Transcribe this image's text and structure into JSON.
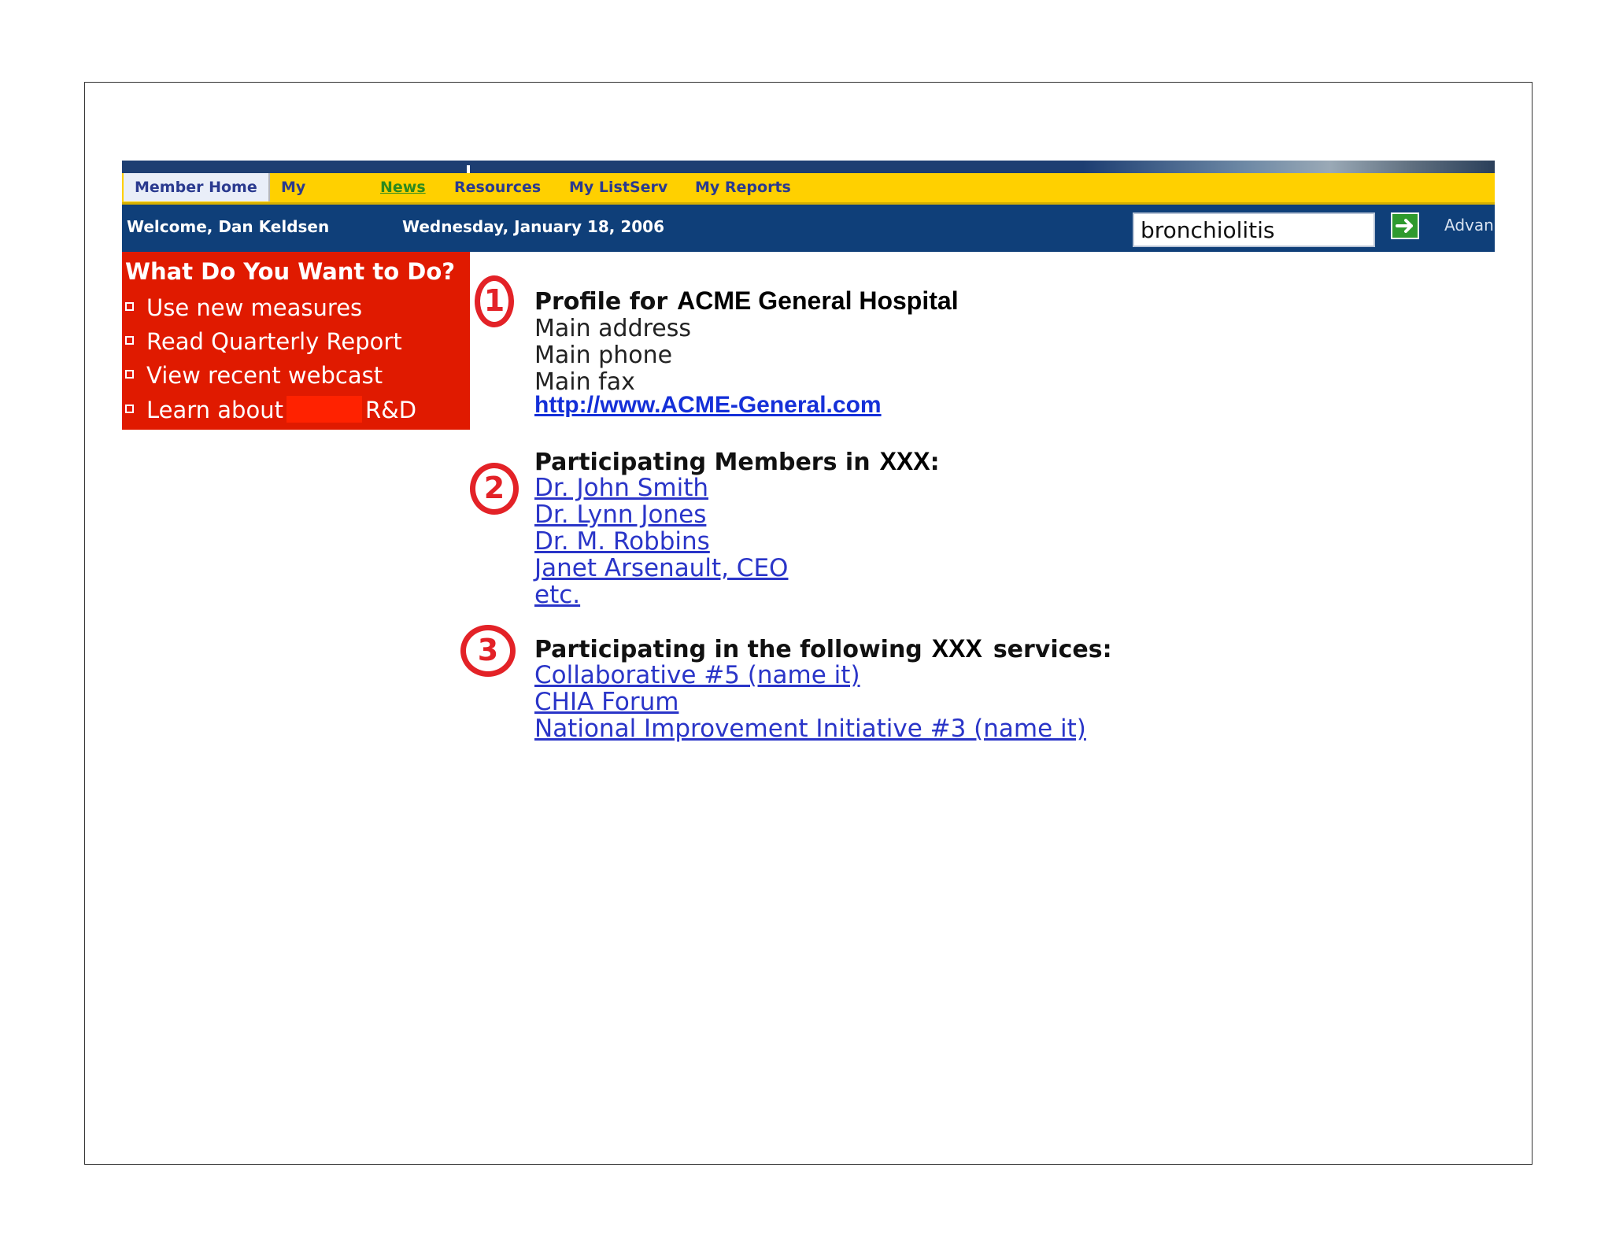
{
  "nav": {
    "tabs": [
      {
        "label": "Member Home"
      },
      {
        "label": "My"
      },
      {
        "label": "News"
      },
      {
        "label": "Resources"
      },
      {
        "label": "My ListServ"
      },
      {
        "label": "My Reports"
      }
    ]
  },
  "welcome": {
    "greeting": "Welcome, Dan Keldsen",
    "date": "Wednesday, January 18, 2006"
  },
  "search": {
    "value": "bronchiolitis",
    "advanced_label": "Advan"
  },
  "sidebar": {
    "title": "What Do You Want to Do?",
    "items": [
      {
        "label": "Use new measures"
      },
      {
        "label": "Read Quarterly Report"
      },
      {
        "label": "View recent webcast"
      },
      {
        "label_prefix": "Learn about",
        "label_suffix": "R&D"
      }
    ]
  },
  "profile": {
    "number": "1",
    "heading": "Profile for",
    "org_name": "ACME General Hospital",
    "lines": [
      "Main address",
      "Main phone",
      "Main fax"
    ],
    "website": "http://www.ACME-General.com"
  },
  "members": {
    "number": "2",
    "heading": "Participating Members in",
    "org_placeholder": "XXX",
    "heading_suffix": ":",
    "list": [
      "Dr. John Smith",
      "Dr. Lynn Jones",
      "Dr. M. Robbins",
      "Janet Arsenault, CEO",
      "etc."
    ]
  },
  "services": {
    "number": "3",
    "heading": "Participating in the following",
    "org_placeholder": "XXX",
    "heading_suffix": "services:",
    "list": [
      "Collaborative #5 (name it)",
      "CHIA Forum",
      "National Improvement Initiative #3 (name it)"
    ]
  },
  "colors": {
    "nav_yellow": "#ffd000",
    "welcome_blue": "#0f3f79",
    "sidebar_red": "#e01a00",
    "annotation_red": "#e32227",
    "link_blue": "#2a35c8"
  }
}
